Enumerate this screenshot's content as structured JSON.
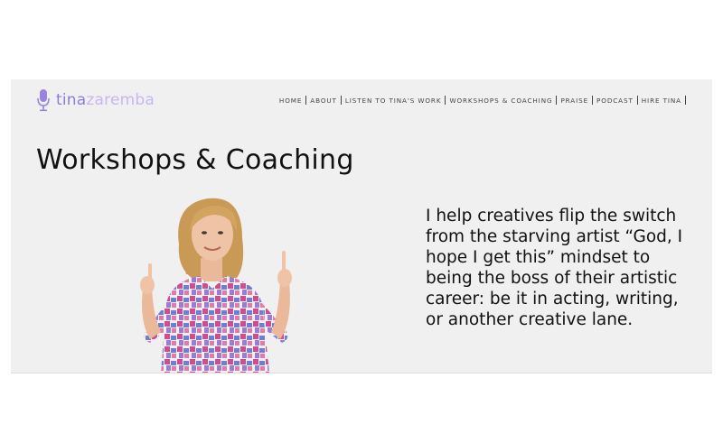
{
  "brand": {
    "first": "tina",
    "last": "zaremba",
    "icon": "microphone-icon",
    "color_primary": "#8e7bd6",
    "color_secondary": "#c7b6f0"
  },
  "nav": {
    "items": [
      {
        "label": "HOME"
      },
      {
        "label": "ABOUT"
      },
      {
        "label": "LISTEN TO TINA'S WORK"
      },
      {
        "label": "WORKSHOPS & COACHING"
      },
      {
        "label": "PRAISE"
      },
      {
        "label": "PODCAST"
      },
      {
        "label": "HIRE TINA"
      }
    ]
  },
  "page": {
    "title": "Workshops & Coaching",
    "intro": "I help creatives flip the switch from the starving artist “God, I hope I get this” mindset to being the boss of their artistic career: be it in acting, writing, or another creative lane."
  },
  "colors": {
    "panel_bg": "#f1f0f1",
    "text": "#111111"
  }
}
